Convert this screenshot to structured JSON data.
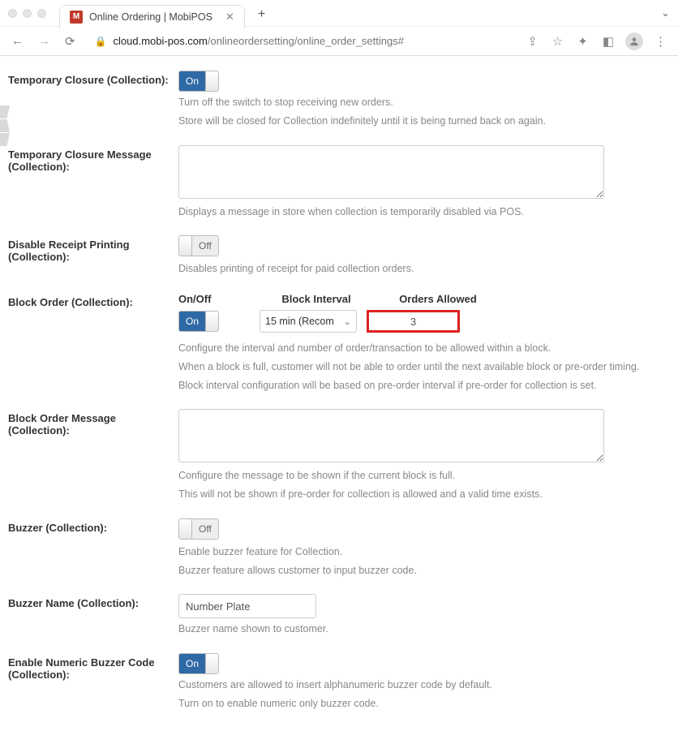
{
  "browser": {
    "tab_title": "Online Ordering | MobiPOS",
    "favicon_letter": "M",
    "url_host": "cloud.mobi-pos.com",
    "url_path": "/onlineordersetting/online_order_settings#"
  },
  "tempClosure": {
    "label": "Temporary Closure (Collection):",
    "toggle": "On",
    "help1": "Turn off the switch to stop receiving new orders.",
    "help2": "Store will be closed for Collection indefinitely until it is being turned back on again."
  },
  "tempClosureMsg": {
    "label": "Temporary Closure Message (Collection):",
    "value": "",
    "help": "Displays a message in store when collection is temporarily disabled via POS."
  },
  "disableReceipt": {
    "label": "Disable Receipt Printing (Collection):",
    "toggle": "Off",
    "help": "Disables printing of receipt for paid collection orders."
  },
  "blockOrder": {
    "label": "Block Order (Collection):",
    "head_onoff": "On/Off",
    "head_interval": "Block Interval",
    "head_orders": "Orders Allowed",
    "toggle": "On",
    "interval": "15 min (Recom",
    "orders": "3",
    "help1": "Configure the interval and number of order/transaction to be allowed within a block.",
    "help2": "When a block is full, customer will not be able to order until the next available block or pre-order timing.",
    "help3": "Block interval configuration will be based on pre-order interval if pre-order for collection is set."
  },
  "blockOrderMsg": {
    "label": "Block Order Message (Collection):",
    "value": "",
    "help1": "Configure the message to be shown if the current block is full.",
    "help2": "This will not be shown if pre-order for collection is allowed and a valid time exists."
  },
  "buzzer": {
    "label": "Buzzer (Collection):",
    "toggle": "Off",
    "help1": "Enable buzzer feature for Collection.",
    "help2": "Buzzer feature allows customer to input buzzer code."
  },
  "buzzerName": {
    "label": "Buzzer Name (Collection):",
    "value": "Number Plate",
    "help": "Buzzer name shown to customer."
  },
  "numericBuzzer": {
    "label": "Enable Numeric Buzzer Code (Collection):",
    "toggle": "On",
    "help1": "Customers are allowed to insert alphanumeric buzzer code by default.",
    "help2": "Turn on to enable numeric only buzzer code."
  }
}
